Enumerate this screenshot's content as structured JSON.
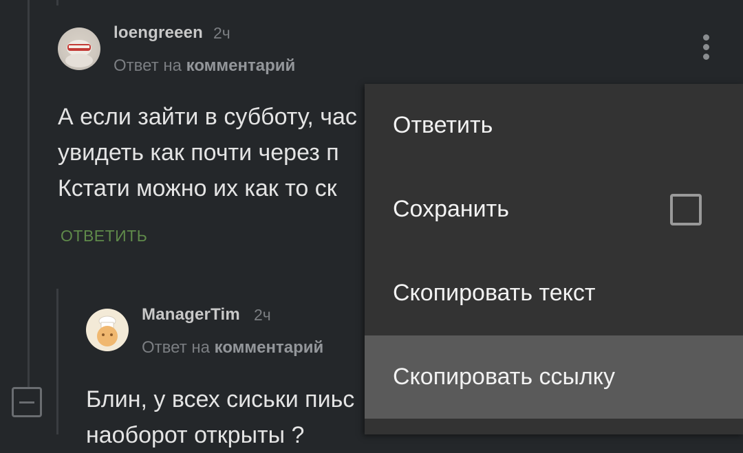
{
  "comments": [
    {
      "username": "loengreeen",
      "time": "2ч",
      "reply_prefix": "Ответ на",
      "reply_target": "комментарий",
      "text": "А если зайти в субботу, час\nувидеть как почти через п\nКстати можно их как то ск",
      "reply_label": "ОТВЕТИТЬ"
    },
    {
      "username": "ManagerTim",
      "time": "2ч",
      "reply_prefix": "Ответ на",
      "reply_target": "комментарий",
      "text": "Блин, у всех сиськи пиьс\nнаоборот открыты ?"
    }
  ],
  "context_menu": {
    "items": [
      {
        "label": "Ответить"
      },
      {
        "label": "Сохранить",
        "checked": false
      },
      {
        "label": "Скопировать текст"
      },
      {
        "label": "Скопировать ссылку",
        "highlighted": true
      }
    ]
  }
}
